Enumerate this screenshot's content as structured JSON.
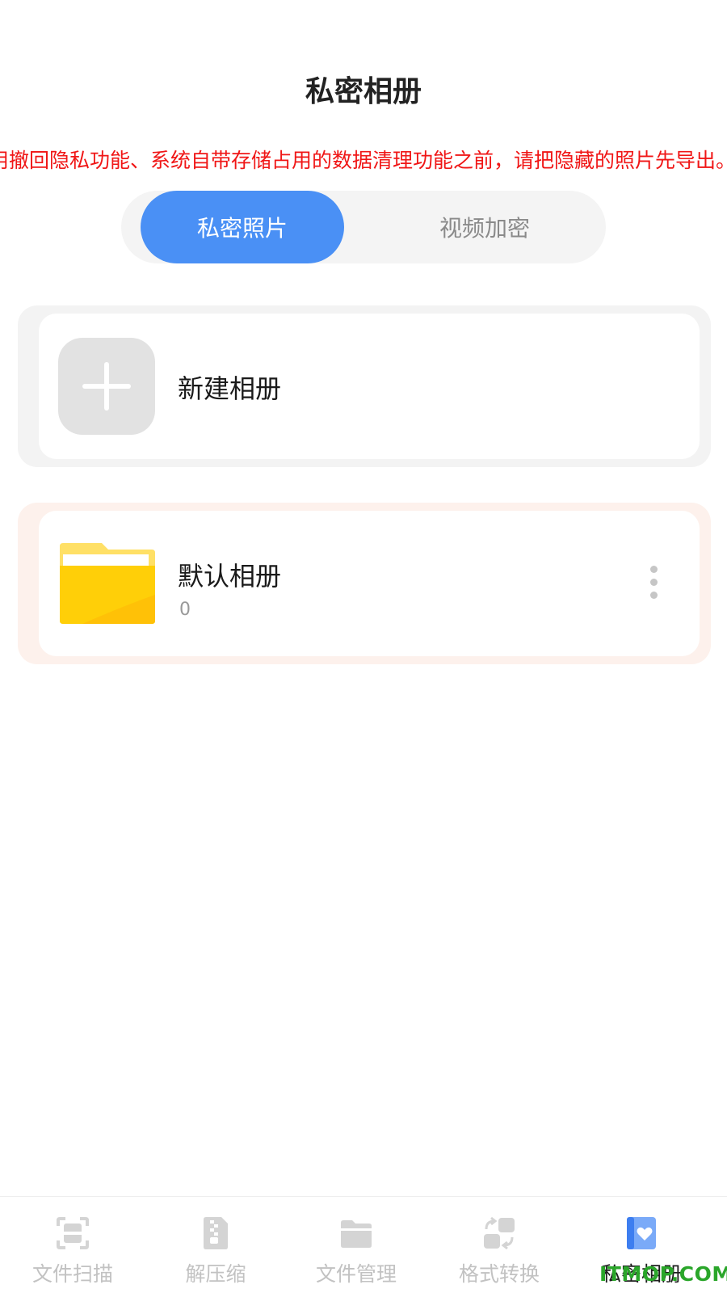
{
  "header": {
    "title": "私密相册"
  },
  "notice": {
    "text": "用撤回隐私功能、系统自带存储占用的数据清理功能之前，请把隐藏的照片先导出。否"
  },
  "segments": {
    "active": "私密照片",
    "inactive": "视频加密"
  },
  "new_album": {
    "label": "新建相册"
  },
  "album": {
    "name": "默认相册",
    "count": "0"
  },
  "tabbar": {
    "items": [
      {
        "label": "文件扫描",
        "icon": "scan-icon"
      },
      {
        "label": "解压缩",
        "icon": "zip-icon"
      },
      {
        "label": "文件管理",
        "icon": "folder-icon"
      },
      {
        "label": "格式转换",
        "icon": "convert-icon"
      },
      {
        "label": "私密相册",
        "icon": "private-album-icon"
      }
    ],
    "active_index": 4
  },
  "watermark": {
    "text": "ITMOP.COM"
  },
  "colors": {
    "accent": "#4a90f5",
    "notice": "#f01616",
    "folder": "#ffcc00",
    "watermark": "#2aa62a"
  }
}
